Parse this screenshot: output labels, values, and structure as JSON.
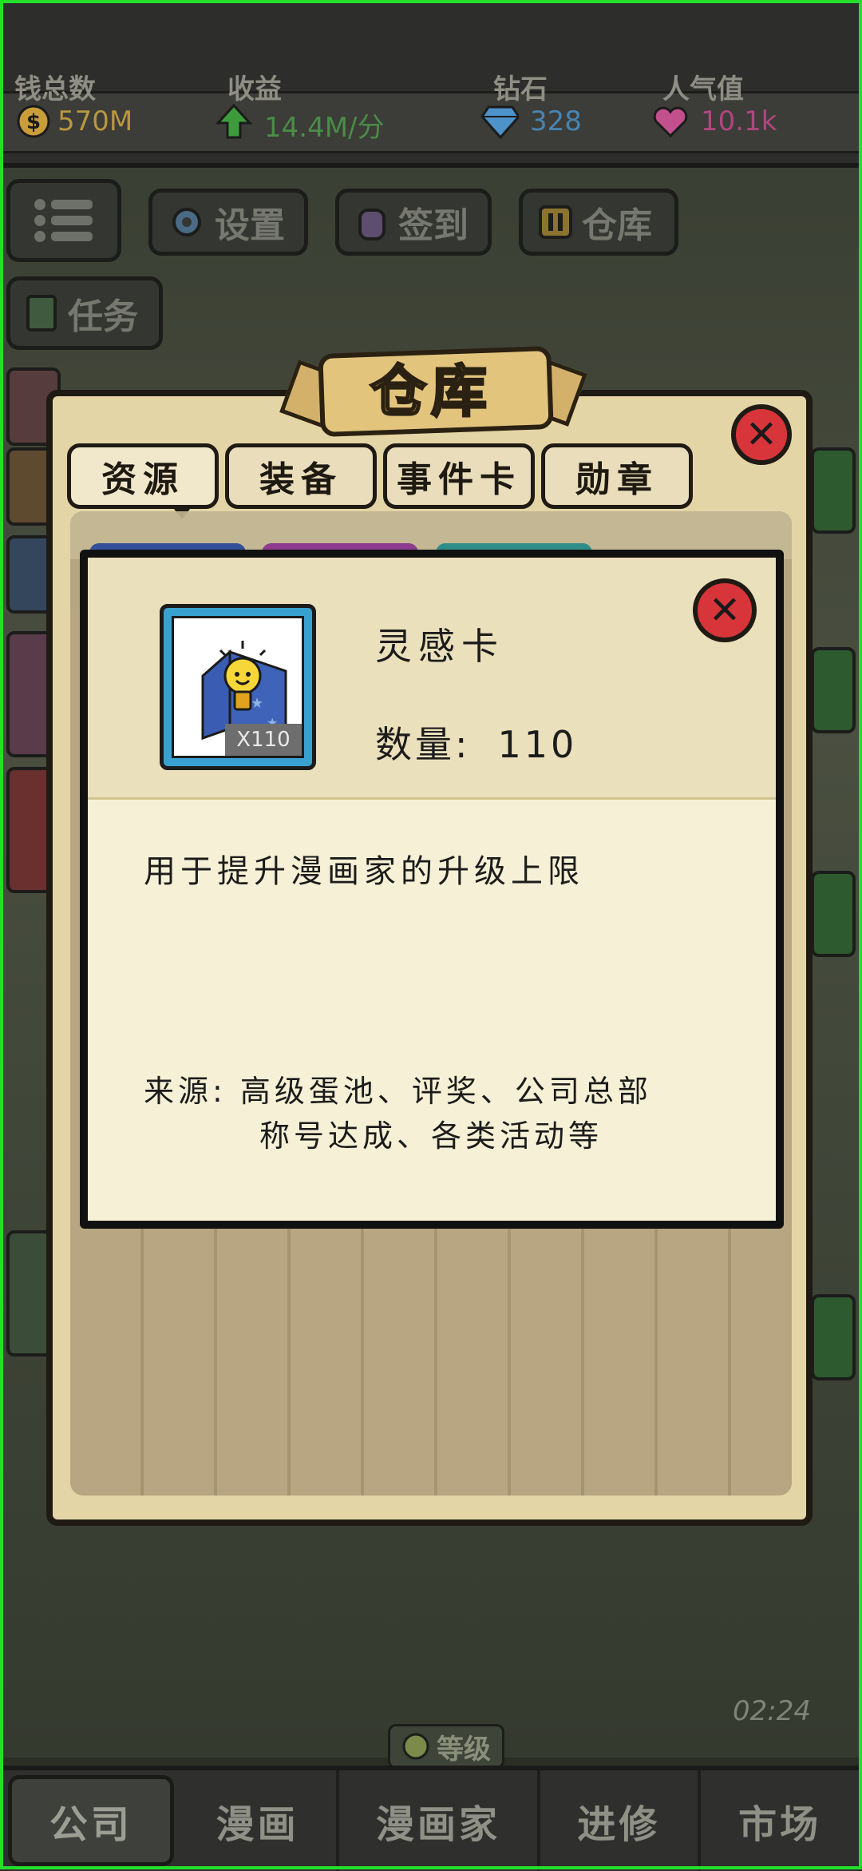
{
  "stats": {
    "money": {
      "label": "钱总数",
      "value": "570M",
      "color": "#cfa63a"
    },
    "income": {
      "label": "收益",
      "value": "14.4M/分",
      "color": "#3e9a3c"
    },
    "diamonds": {
      "label": "钻石",
      "value": "328",
      "color": "#4a8fc6"
    },
    "popularity": {
      "label": "人气值",
      "value": "10.1k",
      "color": "#c24a8b"
    }
  },
  "hud": {
    "settings": "设置",
    "checkin": "签到",
    "warehouse": "仓库",
    "tasks": "任务"
  },
  "panel": {
    "title": "仓库",
    "tabs": [
      "资源",
      "装备",
      "事件卡",
      "勋章"
    ],
    "active_tab": "资源"
  },
  "item_detail": {
    "name": "灵感卡",
    "count_badge": "X110",
    "quantity_label": "数量:",
    "quantity_value": "110",
    "description": "用于提升漫画家的升级上限",
    "source_label": "来源:",
    "source_line1": "高级蛋池、评奖、公司总部",
    "source_line2": "称号达成、各类活动等"
  },
  "status": {
    "timer": "02:24",
    "level_label": "等级"
  },
  "nav": {
    "items": [
      "公司",
      "漫画",
      "漫画家",
      "进修",
      "市场"
    ],
    "active": "公司"
  }
}
